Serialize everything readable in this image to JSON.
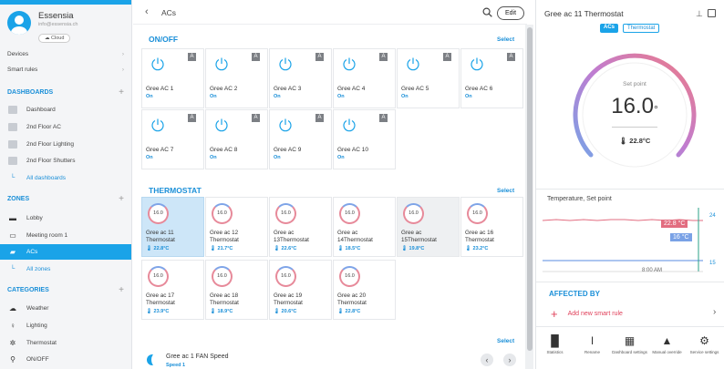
{
  "colors": {
    "accent": "#1aa3e8",
    "link": "#1a8fd8",
    "selected_tile": "#cde6f8",
    "setpoint_red": "#e26d80",
    "current_blue": "#7aa2e6"
  },
  "user": {
    "name": "Essensia",
    "email": "info@essensia.ch",
    "badge": "Cloud"
  },
  "nav": {
    "devices": "Devices",
    "smart_rules": "Smart rules"
  },
  "dashboards": {
    "title": "DASHBOARDS",
    "items": [
      {
        "label": "Dashboard"
      },
      {
        "label": "2nd Floor AC"
      },
      {
        "label": "2nd Floor Lighting"
      },
      {
        "label": "2nd Floor Shutters"
      }
    ],
    "all": "All dashboards"
  },
  "zones": {
    "title": "ZONES",
    "items": [
      {
        "label": "Lobby",
        "icon": "sofa-icon"
      },
      {
        "label": "Meeting room 1",
        "icon": "table-icon"
      },
      {
        "label": "ACs",
        "icon": "folder-icon",
        "active": true
      }
    ],
    "all": "All zones"
  },
  "categories": {
    "title": "CATEGORIES",
    "items": [
      {
        "label": "Weather",
        "icon": "cloud-icon"
      },
      {
        "label": "Lighting",
        "icon": "bulb-icon"
      },
      {
        "label": "Thermostat",
        "icon": "thermostat-icon"
      },
      {
        "label": "ON/OFF",
        "icon": "plug-icon"
      }
    ]
  },
  "header": {
    "breadcrumb": "ACs",
    "edit_label": "Edit"
  },
  "onoff": {
    "title": "ON/OFF",
    "select": "Select",
    "badge": "A",
    "tiles": [
      {
        "name": "Gree AC 1",
        "state": "On"
      },
      {
        "name": "Gree AC 2",
        "state": "On"
      },
      {
        "name": "Gree AC 3",
        "state": "On"
      },
      {
        "name": "Gree AC 4",
        "state": "On"
      },
      {
        "name": "Gree AC 5",
        "state": "On"
      },
      {
        "name": "Gree AC 6",
        "state": "On"
      },
      {
        "name": "Gree AC 7",
        "state": "On"
      },
      {
        "name": "Gree AC 8",
        "state": "On"
      },
      {
        "name": "Gree AC 9",
        "state": "On"
      },
      {
        "name": "Gree AC 10",
        "state": "On"
      }
    ]
  },
  "thermostat": {
    "title": "THERMOSTAT",
    "select": "Select",
    "tiles": [
      {
        "ring": "16.0",
        "name": "Gree ac 11 Thermostat",
        "temp": "🌡 22.8°C",
        "selected": true
      },
      {
        "ring": "16.0",
        "name": "Gree ac 12 Thermostat",
        "temp": "🌡 21.7°C"
      },
      {
        "ring": "16.0",
        "name": "Gree ac 13Thermostat",
        "temp": "🌡 22.6°C"
      },
      {
        "ring": "16.0",
        "name": "Gree ac 14Thermostat",
        "temp": "🌡 18.5°C"
      },
      {
        "ring": "16.0",
        "name": "Gree ac 15Thermostat",
        "temp": "🌡 19.8°C",
        "shaded": true
      },
      {
        "ring": "16.0",
        "name": "Gree ac 16 Thermostat",
        "temp": "🌡 23.2°C"
      },
      {
        "ring": "16.0",
        "name": "Gree ac 17 Thermostat",
        "temp": "🌡 23.9°C"
      },
      {
        "ring": "16.0",
        "name": "Gree ac 18 Thermostat",
        "temp": "🌡 18.9°C"
      },
      {
        "ring": "16.0",
        "name": "Gree ac 19 Thermostat",
        "temp": "🌡 20.6°C"
      },
      {
        "ring": "16.0",
        "name": "Gree ac 20 Thermostat",
        "temp": "🌡 22.8°C"
      }
    ]
  },
  "fan": {
    "select": "Select",
    "name": "Gree ac 1 FAN Speed",
    "sub": "Speed 1"
  },
  "detail": {
    "title": "Gree ac 11 Thermostat",
    "chips": [
      "ACs",
      "Thermostat"
    ],
    "setpoint_label": "Set point",
    "setpoint_value": "16.0",
    "setpoint_unit": "°",
    "current_temp": "🌡 22.8°C",
    "chart_title": "Temperature, Set point",
    "chart_label_temp": "22.8 °C",
    "chart_label_setpoint": "16 °C",
    "y_top": "24",
    "y_bottom": "15",
    "x_label": "8:00 AM",
    "affected_title": "AFFECTED BY",
    "add_rule": "Add new smart rule"
  },
  "toolbar": [
    {
      "label": "Statistics",
      "icon": "bar-chart-icon",
      "glyph": "▐▌"
    },
    {
      "label": "Rename",
      "icon": "text-cursor-icon",
      "glyph": "I"
    },
    {
      "label": "Dashboard settings",
      "icon": "grid-icon",
      "glyph": "▦"
    },
    {
      "label": "Manual override",
      "icon": "person-icon",
      "glyph": "▲"
    },
    {
      "label": "Service settings",
      "icon": "gear-icon",
      "glyph": "⚙"
    }
  ]
}
